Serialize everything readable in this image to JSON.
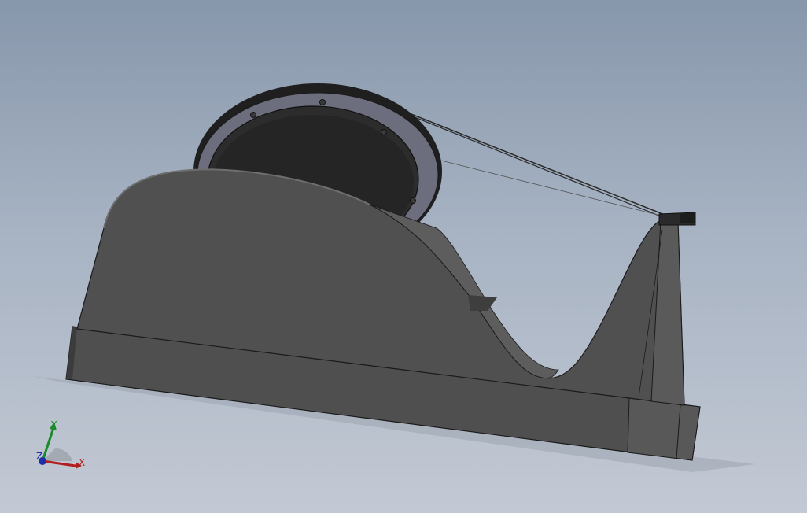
{
  "viewport": {
    "background_top": "#8797ab",
    "background_bottom": "#c3c9d4"
  },
  "model": {
    "name_icon": "tape-dispenser-model",
    "colors": {
      "body": "#4e4e4e",
      "base": "#555555",
      "tape_roll_outer": "#6c6e7d",
      "tape_roll_inner": "#252525",
      "edge": "#1a1a1a"
    }
  },
  "triad": {
    "x_label": "X",
    "y_label": "Y",
    "z_label": "Z",
    "colors": {
      "x": "#b01e1e",
      "y": "#1a8a2a",
      "z": "#1e2ea8"
    }
  }
}
